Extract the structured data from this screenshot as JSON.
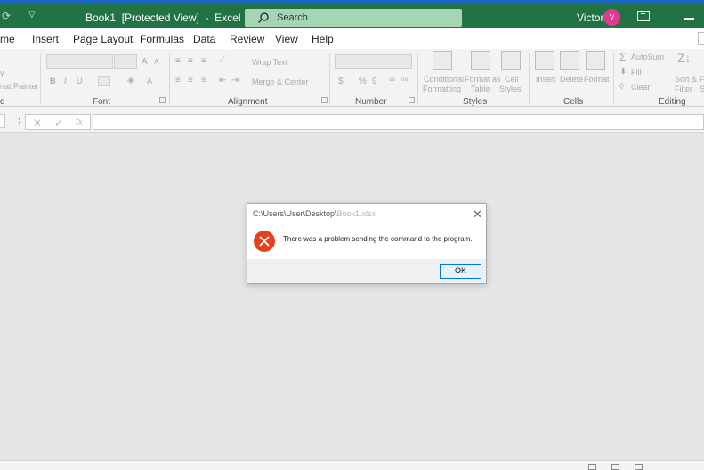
{
  "titlebar": {
    "title": "Book1  [Protected View]  -  Excel",
    "search_placeholder": "Search",
    "user_name": "Victor",
    "user_initial": "V"
  },
  "menu": {
    "tabs": [
      "me",
      "Insert",
      "Page Layout",
      "Formulas",
      "Data",
      "Review",
      "View",
      "Help"
    ]
  },
  "ribbon": {
    "clipboard": {
      "label": "d",
      "copy": "y",
      "format_painter": "nat Painter"
    },
    "font": {
      "label": "Font",
      "bold": "B",
      "italic": "I",
      "underline": "U",
      "grow": "A",
      "shrink": "A",
      "color": "A"
    },
    "alignment": {
      "label": "Alignment",
      "wrap_text": "Wrap Text",
      "merge_center": "Merge & Center"
    },
    "number": {
      "label": "Number",
      "currency": "$",
      "percent": "%",
      "comma": "9"
    },
    "styles": {
      "label": "Styles",
      "conditional_line1": "Conditional",
      "conditional_line2": "Formatting",
      "format_table_line1": "Format as",
      "format_table_line2": "Table",
      "cell_styles_line1": "Cell",
      "cell_styles_line2": "Styles"
    },
    "cells": {
      "label": "Cells",
      "insert": "Insert",
      "delete": "Delete",
      "format": "Format"
    },
    "editing": {
      "label": "Editing",
      "autosum": "AutoSum",
      "fill": "Fill",
      "clear": "Clear",
      "sort_line1": "Sort &",
      "sort_line2": "Filter",
      "find_line1": "F",
      "find_line2": "Se"
    }
  },
  "formula_bar": {
    "cancel": "✕",
    "enter": "✓",
    "function": "fx"
  },
  "dialog": {
    "title_path": "C:\\Users\\User\\Desktop\\",
    "title_file": "Book1.xlsx",
    "message": "There was a problem sending the command to the program.",
    "ok_label": "OK"
  },
  "colors": {
    "excel_green": "#217346",
    "search_box": "#a6d5b6",
    "avatar": "#e03c8f",
    "error_red": "#e7401d",
    "ok_border": "#0078d7"
  }
}
